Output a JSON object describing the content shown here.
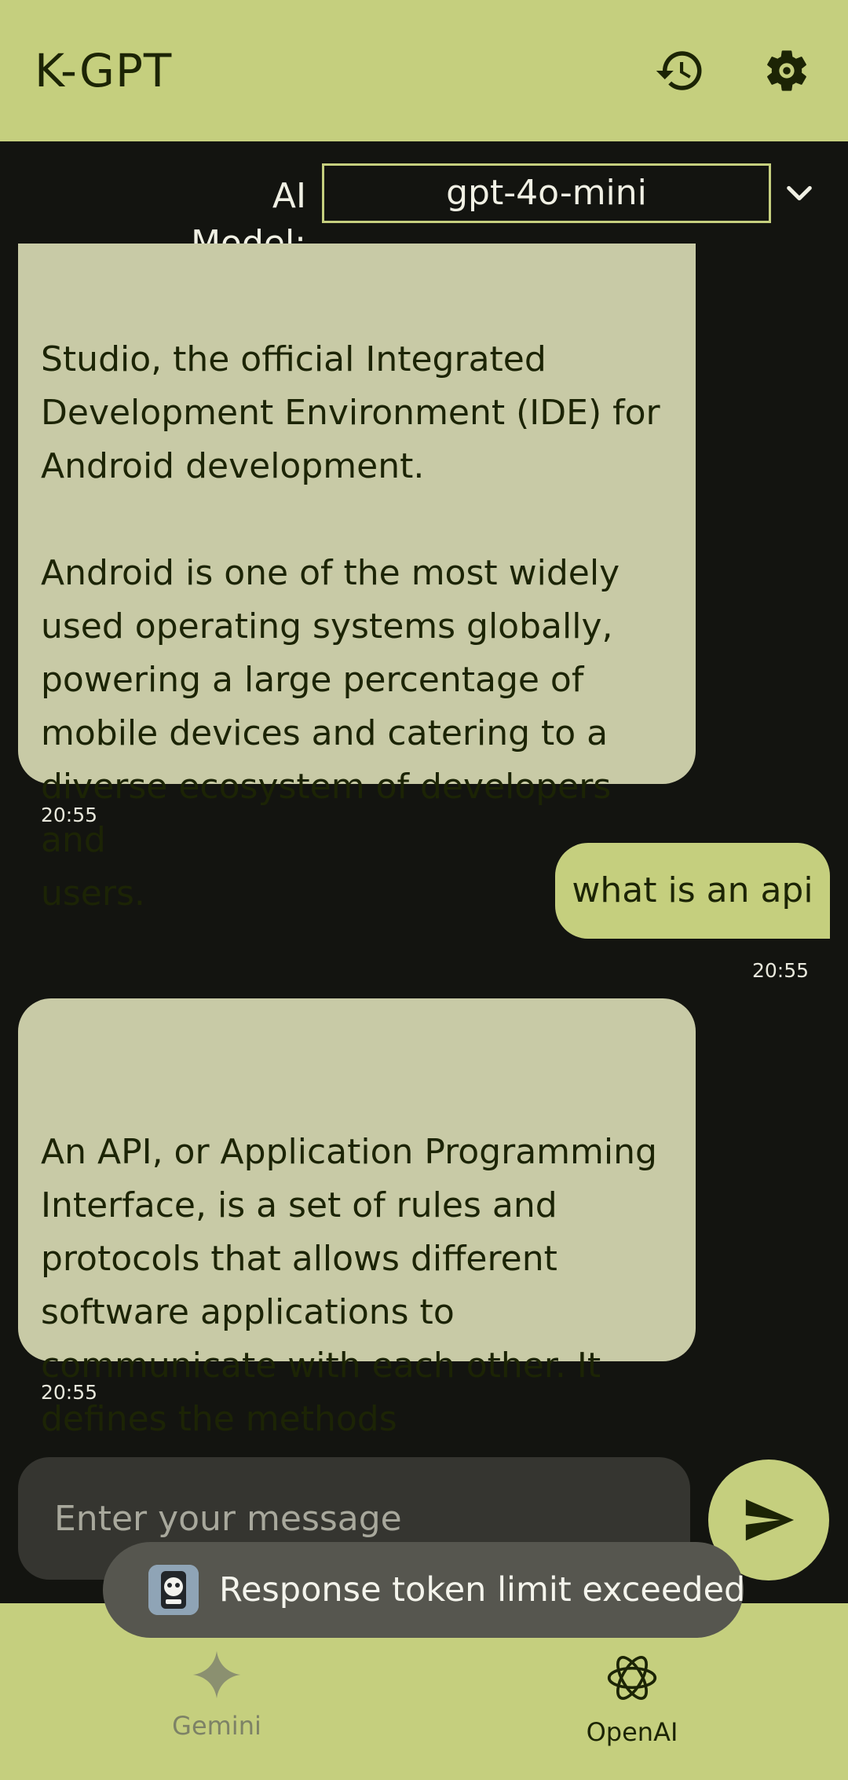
{
  "app": {
    "title": "K-GPT",
    "history_icon": "history-icon",
    "settings_icon": "gear-icon"
  },
  "model_selector": {
    "label": "AI Model:",
    "selected": "gpt-4o-mini"
  },
  "messages": [
    {
      "role": "assistant",
      "text": "Studio, the official Integrated\nDevelopment Environment (IDE) for\nAndroid development.\n\nAndroid is one of the most widely\nused operating systems globally,\npowering a large percentage of\nmobile devices and catering to a\ndiverse ecosystem of developers and\nusers.",
      "time": "20:55"
    },
    {
      "role": "user",
      "text": "what is an api",
      "time": "20:55"
    },
    {
      "role": "assistant",
      "text": "An API, or Application Programming\nInterface, is a set of rules and\nprotocols that allows different\nsoftware applications to\ncommunicate with each other. It\ndefines the methods",
      "time": "20:55"
    }
  ],
  "input": {
    "placeholder": "Enter your message"
  },
  "toast": {
    "text": "Response token limit exceeded"
  },
  "nav": {
    "items": [
      {
        "label": "Gemini",
        "icon": "gemini-sparkle-icon",
        "active": false
      },
      {
        "label": "OpenAI",
        "icon": "openai-logo-icon",
        "active": true
      }
    ]
  },
  "colors": {
    "accent": "#c5cf7e",
    "background": "#131410",
    "assistant_bubble": "#c8caa6",
    "input_bg": "#353530",
    "toast_bg": "#56564f",
    "text_dark": "#1c2405"
  }
}
